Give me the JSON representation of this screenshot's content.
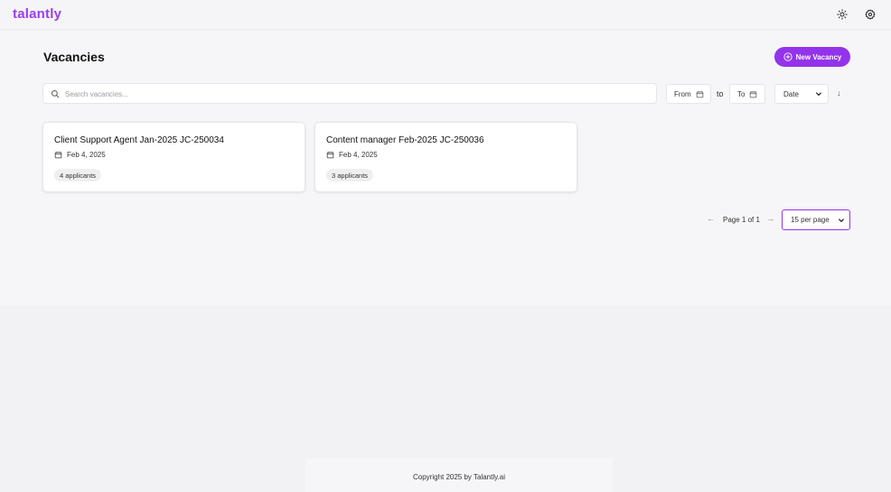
{
  "header": {
    "logo": "talantly",
    "theme_icon": "sun-icon",
    "settings_icon": "gear-icon"
  },
  "page": {
    "title": "Vacancies",
    "new_button_label": "New Vacancy"
  },
  "filters": {
    "search_placeholder": "Search vacancies...",
    "from_label": "From",
    "to_separator": "to",
    "to_label": "To",
    "sort_value": "Date",
    "sort_direction_icon": "↓"
  },
  "vacancies": [
    {
      "title": "Client Support Agent Jan-2025 JC-250034",
      "date": "Feb 4, 2025",
      "applicants": "4 applicants"
    },
    {
      "title": "Content manager Feb-2025 JC-250036",
      "date": "Feb 4, 2025",
      "applicants": "3 applicants"
    }
  ],
  "pagination": {
    "prev": "←",
    "label": "Page 1 of 1",
    "next": "→",
    "per_page": "15 per page"
  },
  "footer": {
    "copyright": "Copyright 2025 by Talantly.ai"
  },
  "colors": {
    "accent": "#9333ea",
    "logo": "#9b3cf0"
  }
}
